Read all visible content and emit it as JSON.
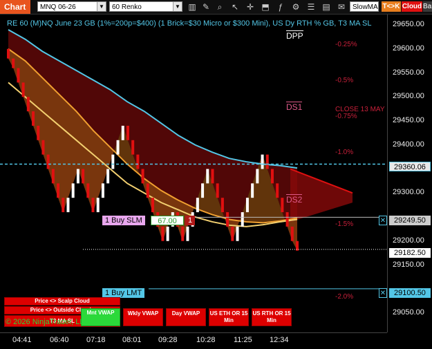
{
  "toolbar": {
    "chart_tab": "Chart",
    "instrument": "MNQ 06-26",
    "bar_type": "60 Renko",
    "indicator_select": "SlowMA",
    "tk_label": "T<>K",
    "cloud_label": "Cloud",
    "bars_label": "Bars"
  },
  "title": "RE 60 (M)NQ June 23 GB (1%=200p=$400) (1 Brick=$30 Micro or $300 Mini), US Dy RTH % GB, T3 MA SL",
  "annotations": {
    "dpp": "DPP",
    "ds1": "DS1",
    "ds2": "DS2",
    "close": "CLOSE 13 MAY",
    "pct": [
      "-0.25%",
      "-0.5%",
      "-0.75%",
      "-1.0%",
      "-1.5%",
      "-2.0%"
    ]
  },
  "yaxis": {
    "ticks": [
      "29650.00",
      "29600.00",
      "29550.00",
      "29500.00",
      "29450.00",
      "29400.00",
      "29300.00",
      "29200.00",
      "29150.00",
      "29050.00"
    ],
    "price_tags": {
      "dashed": "29360.06",
      "buy_slm": "29249.50",
      "last": "29182.50",
      "buy_lmt": "29100.50"
    }
  },
  "xaxis": {
    "ticks": [
      "04:41",
      "06:40",
      "07:18",
      "08:01",
      "09:28",
      "10:28",
      "11:25",
      "12:34"
    ]
  },
  "orders": {
    "buy_slm_label": "1 Buy SLM",
    "buy_slm_price": "67.00",
    "buy_slm_qty": "1",
    "buy_lmt_label": "1 Buy LMT",
    "close_x": "✕"
  },
  "buttons": {
    "scalp": "Price <> Scalp Cloud",
    "outside": "Price <> Outside Clouds",
    "t3": "T3 MA SL",
    "mnt_vwap": "Mnt VWAP",
    "wkly_vwap": "Wkly VWAP",
    "day_vwap": "Day VWAP",
    "us_eth": "US ETH OR 15 Min",
    "us_rth": "US RTH OR 15 Min"
  },
  "copyright": "© 2026 NinjaTrader, LLC",
  "colors": {
    "accent": "#e8541e",
    "cyan": "#53c6e6",
    "bull_brick": "#ffffff",
    "bear_brick": "#e01010",
    "green_button": "#2bd93a"
  },
  "chart_data": {
    "type": "line",
    "series": [
      {
        "values": [
          29640,
          29620,
          29595,
          29575,
          29555,
          29535,
          29515,
          29490,
          29470,
          29445,
          29420,
          29400,
          29385,
          29372,
          29365,
          29360,
          29357,
          29352
        ]
      },
      {
        "values": [
          29600,
          29575,
          29540,
          29505,
          29470,
          29430,
          29395,
          29360,
          29330,
          29305,
          29285,
          29268,
          29255,
          29245,
          29240,
          29238,
          29242,
          29248
        ]
      },
      {
        "values": [
          29530,
          29500,
          29470,
          29440,
          29410,
          29380,
          29350,
          29320,
          29300,
          29280,
          29265,
          29250,
          29240,
          29233,
          29230,
          29234,
          29240,
          29245
        ]
      }
    ],
    "bricks": [
      29580,
      29560,
      29530,
      29500,
      29470,
      29440,
      29410,
      29380,
      29350,
      29320,
      29290,
      29260,
      29290,
      29320,
      29350,
      29320,
      29290,
      29260,
      29290,
      29320,
      29350,
      29380,
      29410,
      29440,
      29410,
      29380,
      29350,
      29320,
      29290,
      29260,
      29230,
      29200,
      29230,
      29260,
      29230,
      29200,
      29230,
      29260,
      29290,
      29320,
      29350,
      29320,
      29290,
      29260,
      29230,
      29200,
      29230,
      29260,
      29290,
      29320,
      29350,
      29380,
      29350,
      29320,
      29290,
      29260,
      29230,
      29200,
      29180
    ]
  }
}
